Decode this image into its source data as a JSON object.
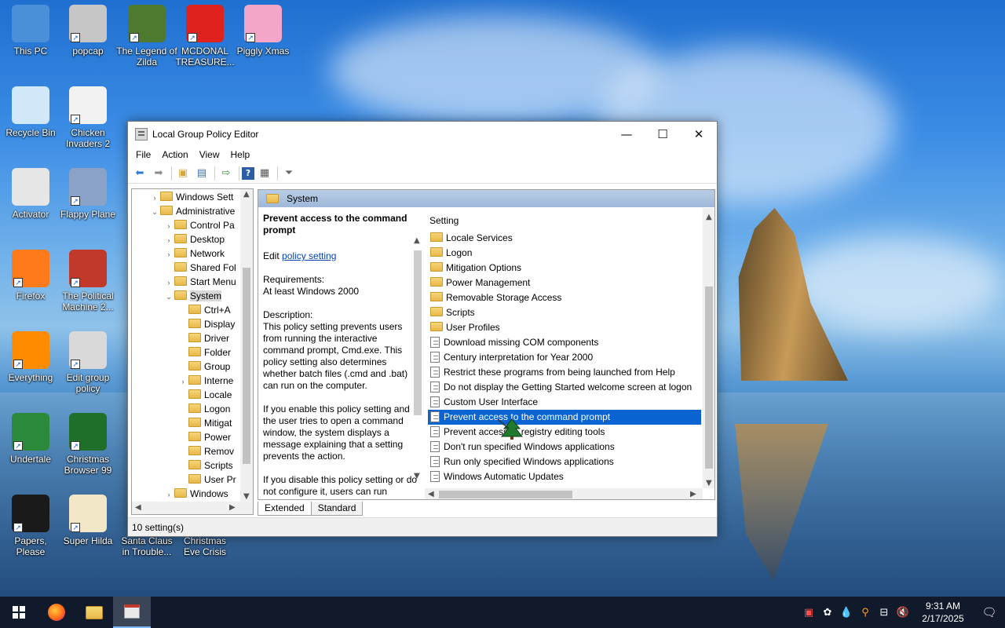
{
  "desktop": {
    "icons": [
      {
        "label": "This PC"
      },
      {
        "label": "popcap"
      },
      {
        "label": "The Legend of Zilda"
      },
      {
        "label": "MCDONAL TREASURE..."
      },
      {
        "label": "Piggly Xmas"
      },
      {
        "label": "Recycle Bin"
      },
      {
        "label": "Chicken Invaders 2"
      },
      {
        "label": "Activator"
      },
      {
        "label": "Flappy Plane"
      },
      {
        "label": "Firefox"
      },
      {
        "label": "The Political Machine 2..."
      },
      {
        "label": "Everything"
      },
      {
        "label": "Edit group policy"
      },
      {
        "label": "Undertale"
      },
      {
        "label": "Christmas Browser 99"
      },
      {
        "label": "Papers, Please"
      },
      {
        "label": "Super Hilda"
      },
      {
        "label": "Santa Claus in Trouble..."
      },
      {
        "label": "Christmas Eve Crisis"
      }
    ]
  },
  "window": {
    "title": "Local Group Policy Editor",
    "controls": {
      "minimize": "—",
      "maximize": "☐",
      "close": "✕"
    },
    "menu": [
      "File",
      "Action",
      "View",
      "Help"
    ],
    "tree": [
      {
        "label": "Windows Sett",
        "expander": "›"
      },
      {
        "label": "Administrative",
        "expander": "⌄"
      },
      {
        "label": "Control Pa",
        "expander": "›"
      },
      {
        "label": "Desktop",
        "expander": "›"
      },
      {
        "label": "Network",
        "expander": "›"
      },
      {
        "label": "Shared Fol",
        "expander": ""
      },
      {
        "label": "Start Menu",
        "expander": "›"
      },
      {
        "label": "System",
        "expander": "⌄"
      },
      {
        "label": "Ctrl+A",
        "expander": ""
      },
      {
        "label": "Display",
        "expander": ""
      },
      {
        "label": "Driver",
        "expander": ""
      },
      {
        "label": "Folder",
        "expander": ""
      },
      {
        "label": "Group",
        "expander": ""
      },
      {
        "label": "Interne",
        "expander": "›"
      },
      {
        "label": "Locale",
        "expander": ""
      },
      {
        "label": "Logon",
        "expander": ""
      },
      {
        "label": "Mitigat",
        "expander": ""
      },
      {
        "label": "Power",
        "expander": ""
      },
      {
        "label": "Remov",
        "expander": ""
      },
      {
        "label": "Scripts",
        "expander": ""
      },
      {
        "label": "User Pr",
        "expander": ""
      },
      {
        "label": "Windows",
        "expander": "›"
      }
    ],
    "right_header": "System",
    "description": {
      "heading": "Prevent access to the command prompt",
      "edit_prefix": "Edit",
      "edit_link": "policy setting",
      "requirements_label": "Requirements:",
      "requirements": "At least Windows 2000",
      "description_label": "Description:",
      "p1": "This policy setting prevents users from running the interactive command prompt, Cmd.exe.  This policy setting also determines whether batch files (.cmd and .bat) can run on the computer.",
      "p2": "If you enable this policy setting and the user tries to open a command window, the system displays a message explaining that a setting prevents the action.",
      "p3": "If you disable this policy setting or do not configure it, users can run"
    },
    "list_header": "Setting",
    "settings": [
      {
        "label": "Locale Services",
        "kind": "folder"
      },
      {
        "label": "Logon",
        "kind": "folder"
      },
      {
        "label": "Mitigation Options",
        "kind": "folder"
      },
      {
        "label": "Power Management",
        "kind": "folder"
      },
      {
        "label": "Removable Storage Access",
        "kind": "folder"
      },
      {
        "label": "Scripts",
        "kind": "folder"
      },
      {
        "label": "User Profiles",
        "kind": "folder"
      },
      {
        "label": "Download missing COM components",
        "kind": "policy"
      },
      {
        "label": "Century interpretation for Year 2000",
        "kind": "policy"
      },
      {
        "label": "Restrict these programs from being launched from Help",
        "kind": "policy"
      },
      {
        "label": "Do not display the Getting Started welcome screen at logon",
        "kind": "policy"
      },
      {
        "label": "Custom User Interface",
        "kind": "policy"
      },
      {
        "label": "Prevent access to the command prompt",
        "kind": "policy",
        "selected": true
      },
      {
        "label": "Prevent access to registry editing tools",
        "kind": "policy"
      },
      {
        "label": "Don't run specified Windows applications",
        "kind": "policy"
      },
      {
        "label": "Run only specified Windows applications",
        "kind": "policy"
      },
      {
        "label": "Windows Automatic Updates",
        "kind": "policy"
      }
    ],
    "tabs": [
      "Extended",
      "Standard"
    ],
    "status": "10 setting(s)"
  },
  "taskbar": {
    "time": "9:31 AM",
    "date": "2/17/2025"
  },
  "colors": {
    "selection": "#0a64d2",
    "taskbar": "#101a2a",
    "header": "#a9c1df"
  }
}
